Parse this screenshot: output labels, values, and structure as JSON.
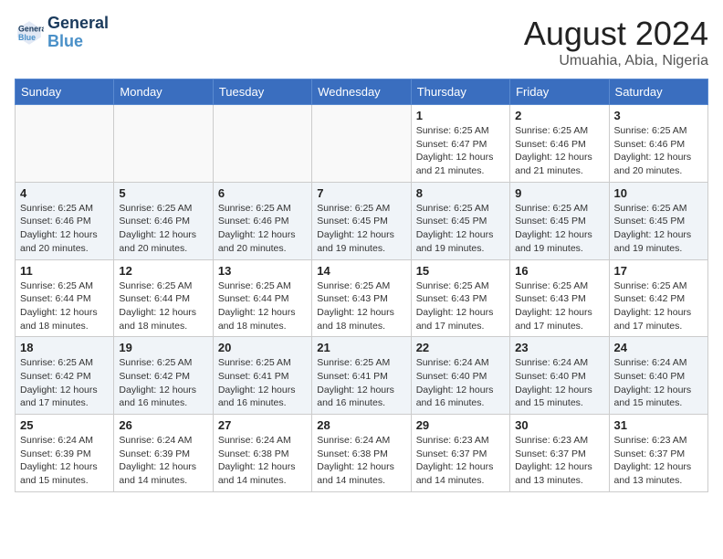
{
  "logo": {
    "line1": "General",
    "line2": "Blue"
  },
  "title": "August 2024",
  "location": "Umuahia, Abia, Nigeria",
  "days_of_week": [
    "Sunday",
    "Monday",
    "Tuesday",
    "Wednesday",
    "Thursday",
    "Friday",
    "Saturday"
  ],
  "weeks": [
    [
      {
        "day": "",
        "info": ""
      },
      {
        "day": "",
        "info": ""
      },
      {
        "day": "",
        "info": ""
      },
      {
        "day": "",
        "info": ""
      },
      {
        "day": "1",
        "info": "Sunrise: 6:25 AM\nSunset: 6:47 PM\nDaylight: 12 hours\nand 21 minutes."
      },
      {
        "day": "2",
        "info": "Sunrise: 6:25 AM\nSunset: 6:46 PM\nDaylight: 12 hours\nand 21 minutes."
      },
      {
        "day": "3",
        "info": "Sunrise: 6:25 AM\nSunset: 6:46 PM\nDaylight: 12 hours\nand 20 minutes."
      }
    ],
    [
      {
        "day": "4",
        "info": "Sunrise: 6:25 AM\nSunset: 6:46 PM\nDaylight: 12 hours\nand 20 minutes."
      },
      {
        "day": "5",
        "info": "Sunrise: 6:25 AM\nSunset: 6:46 PM\nDaylight: 12 hours\nand 20 minutes."
      },
      {
        "day": "6",
        "info": "Sunrise: 6:25 AM\nSunset: 6:46 PM\nDaylight: 12 hours\nand 20 minutes."
      },
      {
        "day": "7",
        "info": "Sunrise: 6:25 AM\nSunset: 6:45 PM\nDaylight: 12 hours\nand 19 minutes."
      },
      {
        "day": "8",
        "info": "Sunrise: 6:25 AM\nSunset: 6:45 PM\nDaylight: 12 hours\nand 19 minutes."
      },
      {
        "day": "9",
        "info": "Sunrise: 6:25 AM\nSunset: 6:45 PM\nDaylight: 12 hours\nand 19 minutes."
      },
      {
        "day": "10",
        "info": "Sunrise: 6:25 AM\nSunset: 6:45 PM\nDaylight: 12 hours\nand 19 minutes."
      }
    ],
    [
      {
        "day": "11",
        "info": "Sunrise: 6:25 AM\nSunset: 6:44 PM\nDaylight: 12 hours\nand 18 minutes."
      },
      {
        "day": "12",
        "info": "Sunrise: 6:25 AM\nSunset: 6:44 PM\nDaylight: 12 hours\nand 18 minutes."
      },
      {
        "day": "13",
        "info": "Sunrise: 6:25 AM\nSunset: 6:44 PM\nDaylight: 12 hours\nand 18 minutes."
      },
      {
        "day": "14",
        "info": "Sunrise: 6:25 AM\nSunset: 6:43 PM\nDaylight: 12 hours\nand 18 minutes."
      },
      {
        "day": "15",
        "info": "Sunrise: 6:25 AM\nSunset: 6:43 PM\nDaylight: 12 hours\nand 17 minutes."
      },
      {
        "day": "16",
        "info": "Sunrise: 6:25 AM\nSunset: 6:43 PM\nDaylight: 12 hours\nand 17 minutes."
      },
      {
        "day": "17",
        "info": "Sunrise: 6:25 AM\nSunset: 6:42 PM\nDaylight: 12 hours\nand 17 minutes."
      }
    ],
    [
      {
        "day": "18",
        "info": "Sunrise: 6:25 AM\nSunset: 6:42 PM\nDaylight: 12 hours\nand 17 minutes."
      },
      {
        "day": "19",
        "info": "Sunrise: 6:25 AM\nSunset: 6:42 PM\nDaylight: 12 hours\nand 16 minutes."
      },
      {
        "day": "20",
        "info": "Sunrise: 6:25 AM\nSunset: 6:41 PM\nDaylight: 12 hours\nand 16 minutes."
      },
      {
        "day": "21",
        "info": "Sunrise: 6:25 AM\nSunset: 6:41 PM\nDaylight: 12 hours\nand 16 minutes."
      },
      {
        "day": "22",
        "info": "Sunrise: 6:24 AM\nSunset: 6:40 PM\nDaylight: 12 hours\nand 16 minutes."
      },
      {
        "day": "23",
        "info": "Sunrise: 6:24 AM\nSunset: 6:40 PM\nDaylight: 12 hours\nand 15 minutes."
      },
      {
        "day": "24",
        "info": "Sunrise: 6:24 AM\nSunset: 6:40 PM\nDaylight: 12 hours\nand 15 minutes."
      }
    ],
    [
      {
        "day": "25",
        "info": "Sunrise: 6:24 AM\nSunset: 6:39 PM\nDaylight: 12 hours\nand 15 minutes."
      },
      {
        "day": "26",
        "info": "Sunrise: 6:24 AM\nSunset: 6:39 PM\nDaylight: 12 hours\nand 14 minutes."
      },
      {
        "day": "27",
        "info": "Sunrise: 6:24 AM\nSunset: 6:38 PM\nDaylight: 12 hours\nand 14 minutes."
      },
      {
        "day": "28",
        "info": "Sunrise: 6:24 AM\nSunset: 6:38 PM\nDaylight: 12 hours\nand 14 minutes."
      },
      {
        "day": "29",
        "info": "Sunrise: 6:23 AM\nSunset: 6:37 PM\nDaylight: 12 hours\nand 14 minutes."
      },
      {
        "day": "30",
        "info": "Sunrise: 6:23 AM\nSunset: 6:37 PM\nDaylight: 12 hours\nand 13 minutes."
      },
      {
        "day": "31",
        "info": "Sunrise: 6:23 AM\nSunset: 6:37 PM\nDaylight: 12 hours\nand 13 minutes."
      }
    ]
  ]
}
